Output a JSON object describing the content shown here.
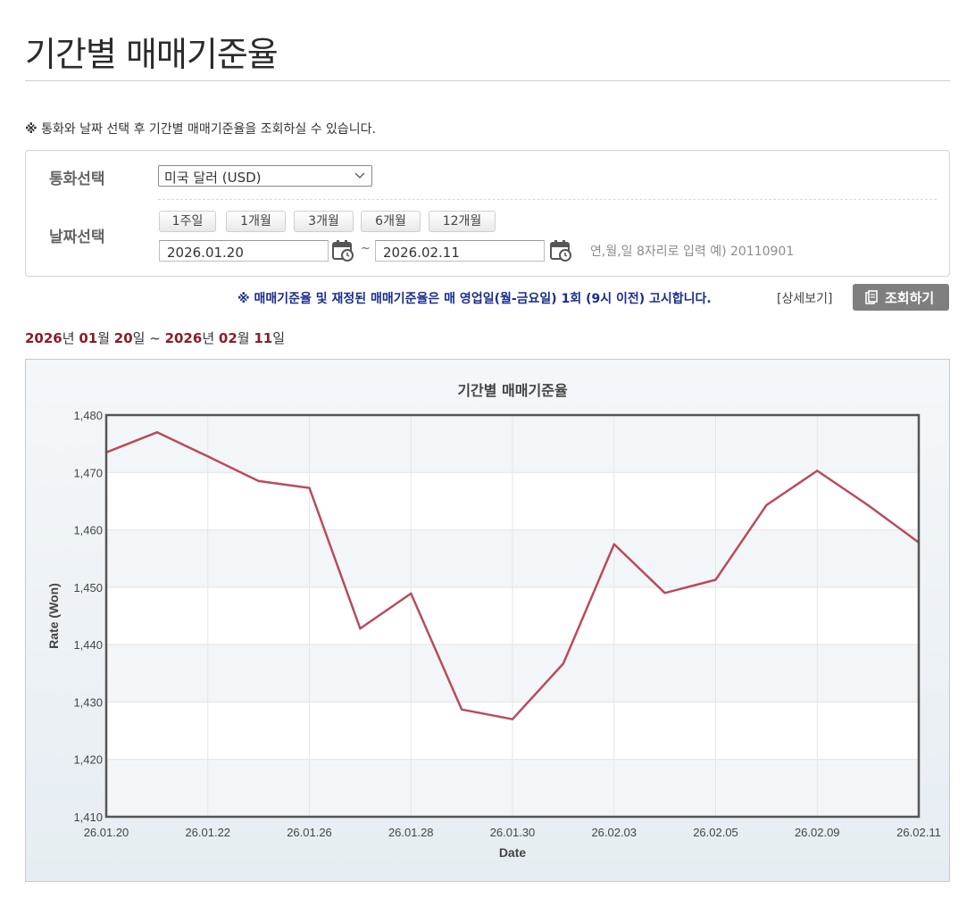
{
  "page": {
    "title": "기간별 매매기준율",
    "notice_mark": "※",
    "notice_text": "통화와 날짜 선택 후 기간별 매매기준율을 조회하실 수 있습니다."
  },
  "form": {
    "currency_label": "통화선택",
    "currency_value": "미국 달러 (USD)",
    "date_label": "날짜선택",
    "period_buttons": [
      "1주일",
      "1개월",
      "3개월",
      "6개월",
      "12개월"
    ],
    "start_date": "2026.01.20",
    "tilde": "~",
    "end_date": "2026.02.11",
    "hint": "연,월,일 8자리로 입력 예) 20110901"
  },
  "actions": {
    "notice": "※ 매매기준율 및 재정된 매매기준율은 매 영업일(월-금요일) 1회 (9시 이전) 고시합니다.",
    "detail_link": "[상세보기]",
    "query_button": "조회하기"
  },
  "range": {
    "start_year": "2026",
    "start_year_unit": "년 ",
    "start_month": "01",
    "start_month_unit": "월 ",
    "start_day": "20",
    "start_day_unit": "일 ~ ",
    "end_year": "2026",
    "end_year_unit": "년 ",
    "end_month": "02",
    "end_month_unit": "월 ",
    "end_day": "11",
    "end_day_unit": "일"
  },
  "chart_data": {
    "type": "line",
    "title": "기간별 매매기준율",
    "xlabel": "Date",
    "ylabel": "Rate (Won)",
    "ylim": [
      1410,
      1480
    ],
    "yticks": [
      1410,
      1420,
      1430,
      1440,
      1450,
      1460,
      1470,
      1480
    ],
    "ytick_labels": [
      "1,410",
      "1,420",
      "1,430",
      "1,440",
      "1,450",
      "1,460",
      "1,470",
      "1,480"
    ],
    "x": [
      "26.01.20",
      "26.01.21",
      "26.01.22",
      "26.01.23",
      "26.01.26",
      "26.01.27",
      "26.01.28",
      "26.01.29",
      "26.01.30",
      "26.02.02",
      "26.02.03",
      "26.02.04",
      "26.02.05",
      "26.02.06",
      "26.02.09",
      "26.02.10",
      "26.02.11"
    ],
    "xtick_labels": [
      "26.01.20",
      "26.01.22",
      "26.01.26",
      "26.01.28",
      "26.01.30",
      "26.02.03",
      "26.02.05",
      "26.02.09",
      "26.02.11"
    ],
    "series": [
      {
        "values": [
          1473.5,
          1477.0,
          1472.8,
          1468.5,
          1467.3,
          1442.8,
          1448.9,
          1428.7,
          1427.0,
          1436.7,
          1457.5,
          1449.0,
          1451.3,
          1464.3,
          1470.3,
          1464.3,
          1457.8
        ],
        "color": "#b94b5c"
      }
    ],
    "grid": true,
    "legend": "none"
  },
  "colors": {
    "line": "#b94b5c",
    "accent_red": "#8a1c2a",
    "notice_blue": "#1a2d8c"
  }
}
